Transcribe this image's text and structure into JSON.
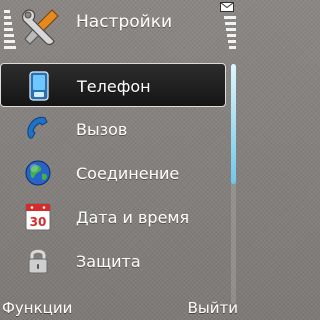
{
  "header": {
    "title": "Настройки",
    "icon": "wrench-screwdriver-icon"
  },
  "status": {
    "signal_level": 1.0,
    "battery_level": 1.0,
    "message_indicator": "envelope-icon"
  },
  "menu": {
    "items": [
      {
        "label": "Телефон",
        "icon": "phone-icon",
        "selected": true
      },
      {
        "label": "Вызов",
        "icon": "call-icon",
        "selected": false
      },
      {
        "label": "Соединение",
        "icon": "globe-icon",
        "selected": false
      },
      {
        "label": "Дата и время",
        "icon": "calendar-icon",
        "calendar_day": "30",
        "selected": false
      },
      {
        "label": "Защита",
        "icon": "lock-icon",
        "selected": false
      }
    ]
  },
  "scrollbar": {
    "position": 0.0,
    "visible_fraction": 0.5
  },
  "softkeys": {
    "left": "Функции",
    "right": "Выйти"
  },
  "colors": {
    "accent": "#6fc7e8",
    "selection_bg": "#1f1f1f",
    "text": "#ffffff"
  }
}
